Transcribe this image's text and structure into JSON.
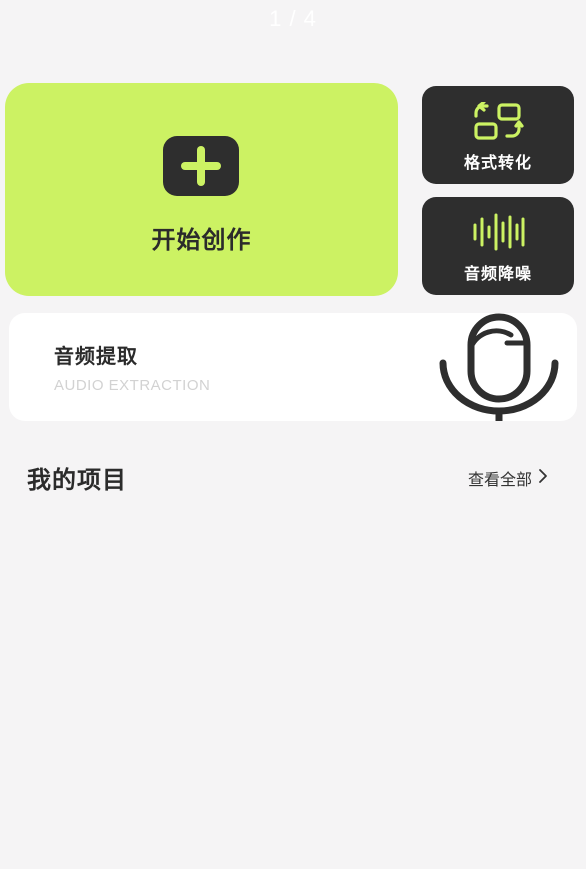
{
  "header": {
    "page_indicator": "1 / 4"
  },
  "create": {
    "label": "开始创作",
    "icon": "plus-icon"
  },
  "tools": [
    {
      "label": "格式转化",
      "icon": "format-convert-icon"
    },
    {
      "label": "音频降噪",
      "icon": "waveform-icon"
    }
  ],
  "extract": {
    "title": "音频提取",
    "subtitle": "AUDIO EXTRACTION",
    "icon": "microphone-icon"
  },
  "projects": {
    "title": "我的项目",
    "view_all_label": "查看全部",
    "view_all_icon": "chevron-right-icon"
  },
  "colors": {
    "accent": "#ccf263",
    "dark_card": "#2e2e2e",
    "background": "#f5f4f5",
    "text": "#2b2b2b"
  }
}
